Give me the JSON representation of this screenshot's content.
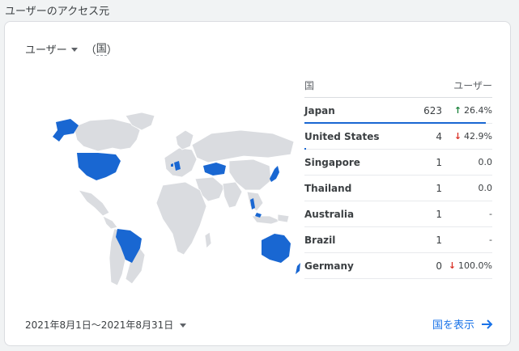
{
  "page": {
    "heading": "ユーザーのアクセス元"
  },
  "card": {
    "metric_label": "ユーザー",
    "dimension_open": "（",
    "dimension_label": "国",
    "dimension_close": "）"
  },
  "table": {
    "header_country": "国",
    "header_users": "ユーザー",
    "rows": [
      {
        "country": "Japan",
        "users": "623",
        "delta": "26.4%",
        "direction": "up",
        "share": 0.99
      },
      {
        "country": "United States",
        "users": "4",
        "delta": "42.9%",
        "direction": "down",
        "share": 0.006
      },
      {
        "country": "Singapore",
        "users": "1",
        "delta": "0.0",
        "direction": "none",
        "share": 0
      },
      {
        "country": "Thailand",
        "users": "1",
        "delta": "0.0",
        "direction": "none",
        "share": 0
      },
      {
        "country": "Australia",
        "users": "1",
        "delta": "-",
        "direction": "none",
        "share": 0
      },
      {
        "country": "Brazil",
        "users": "1",
        "delta": "-",
        "direction": "none",
        "share": 0
      },
      {
        "country": "Germany",
        "users": "0",
        "delta": "100.0%",
        "direction": "down",
        "share": 0
      }
    ]
  },
  "footer": {
    "date_range": "2021年8月1日～2021年8月31日",
    "view_link": "国を表示"
  },
  "colors": {
    "accent": "#1a73e8",
    "map_highlight": "#1967d2",
    "map_base": "#dadce0",
    "up": "#188038",
    "down": "#d93025"
  }
}
